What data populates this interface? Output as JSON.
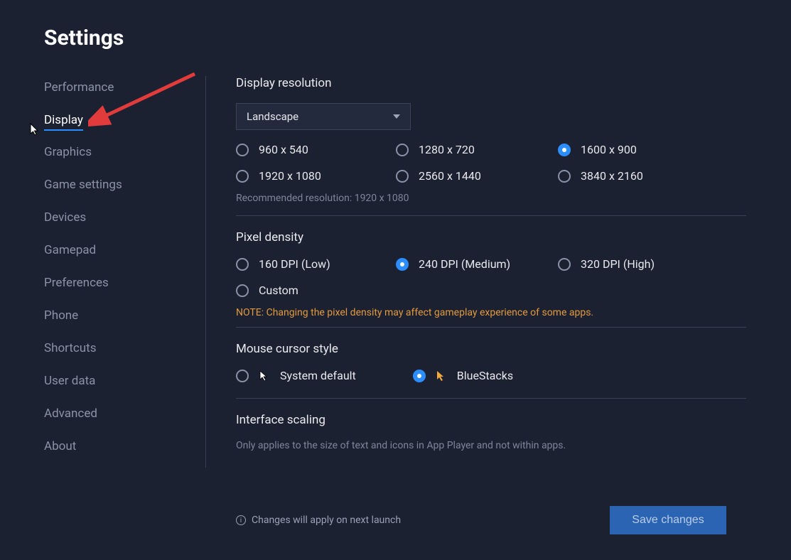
{
  "title": "Settings",
  "sidebar": {
    "items": [
      {
        "label": "Performance"
      },
      {
        "label": "Display",
        "active": true
      },
      {
        "label": "Graphics"
      },
      {
        "label": "Game settings"
      },
      {
        "label": "Devices"
      },
      {
        "label": "Gamepad"
      },
      {
        "label": "Preferences"
      },
      {
        "label": "Phone"
      },
      {
        "label": "Shortcuts"
      },
      {
        "label": "User data"
      },
      {
        "label": "Advanced"
      },
      {
        "label": "About"
      }
    ]
  },
  "display": {
    "resolution_title": "Display resolution",
    "orientation": "Landscape",
    "resolutions": [
      {
        "label": "960 x 540"
      },
      {
        "label": "1280 x 720"
      },
      {
        "label": "1600 x 900",
        "checked": true
      },
      {
        "label": "1920 x 1080"
      },
      {
        "label": "2560 x 1440"
      },
      {
        "label": "3840 x 2160"
      }
    ],
    "recommended": "Recommended resolution: 1920 x 1080",
    "dpi_title": "Pixel density",
    "dpis": [
      {
        "label": "160 DPI (Low)"
      },
      {
        "label": "240 DPI (Medium)",
        "checked": true
      },
      {
        "label": "320 DPI (High)"
      },
      {
        "label": "Custom"
      }
    ],
    "dpi_note": "NOTE: Changing the pixel density may affect gameplay experience of some apps.",
    "cursor_title": "Mouse cursor style",
    "cursors": [
      {
        "label": "System default"
      },
      {
        "label": "BlueStacks",
        "checked": true
      }
    ],
    "scaling_title": "Interface scaling",
    "scaling_hint": "Only applies to the size of text and icons in App Player and not within apps."
  },
  "footer": {
    "note": "Changes will apply on next launch",
    "save": "Save changes"
  }
}
